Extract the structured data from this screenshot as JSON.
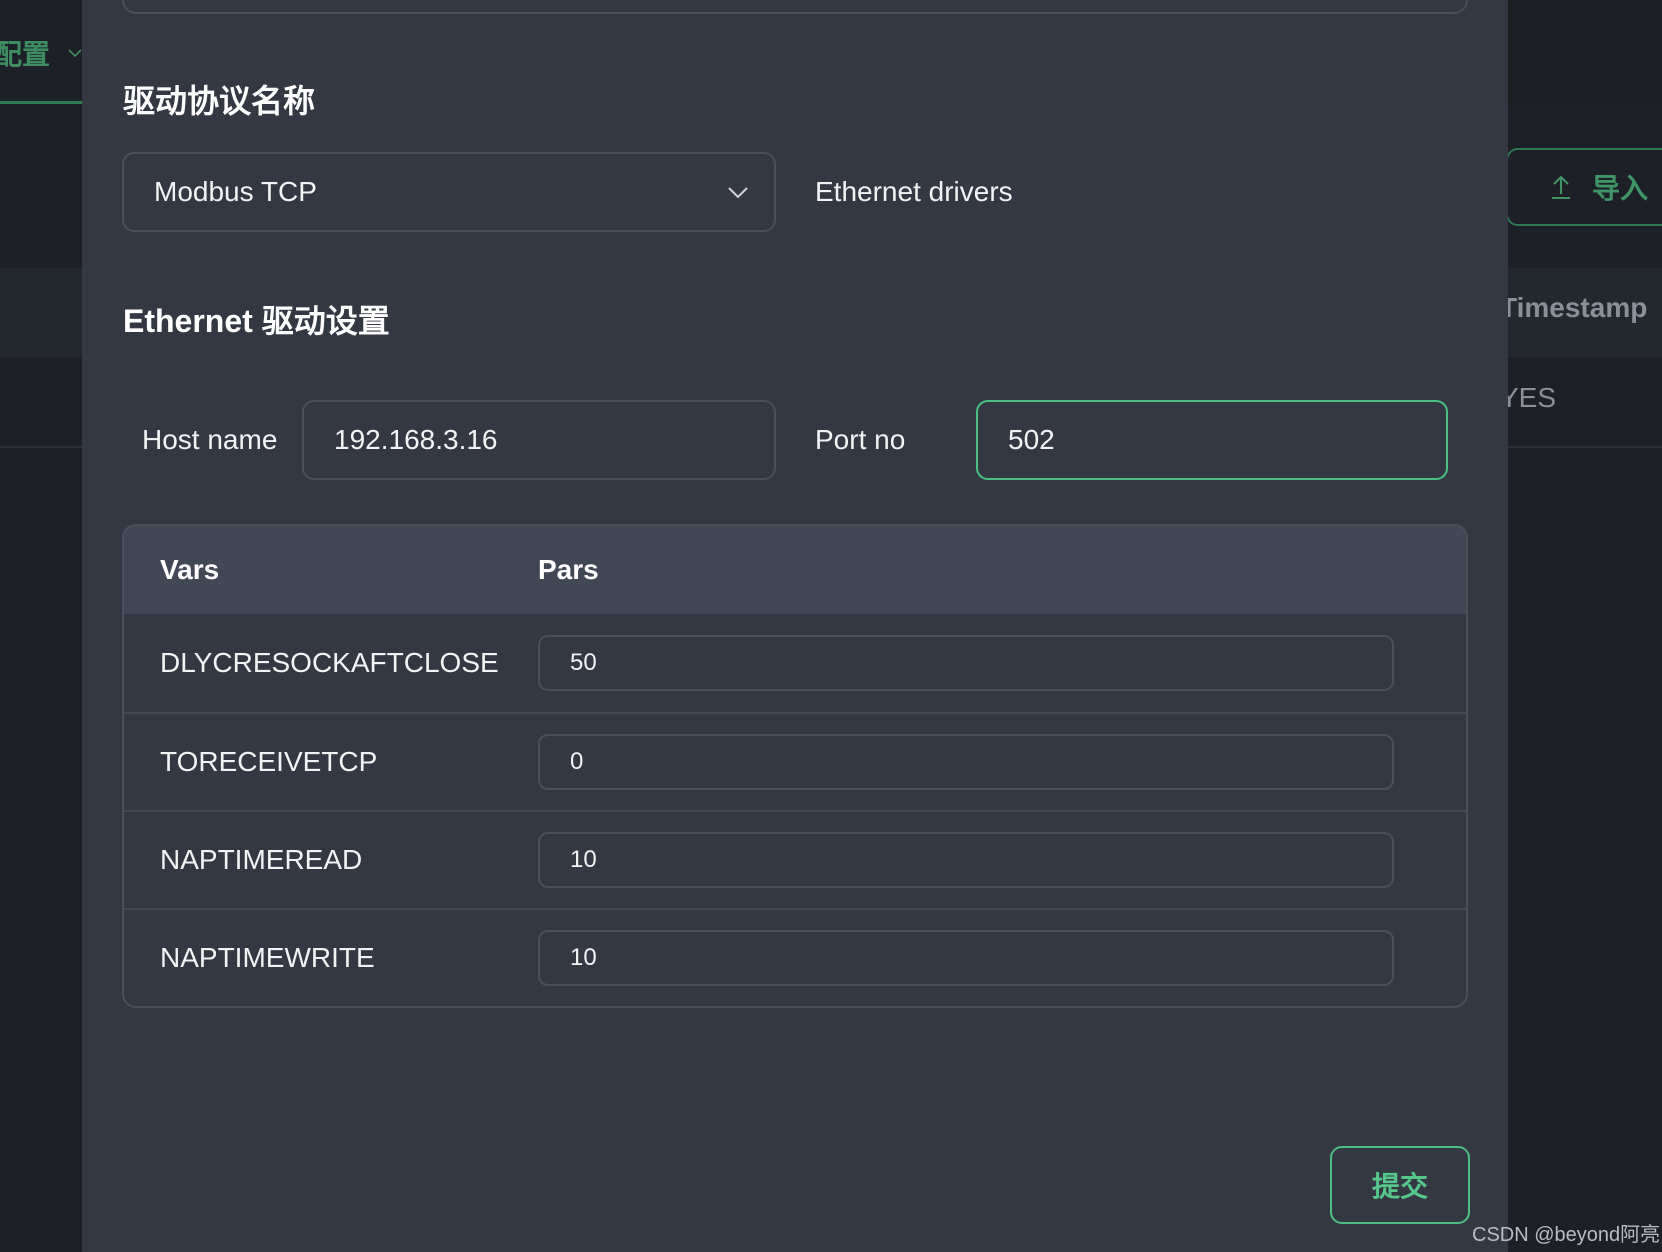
{
  "background": {
    "left_tab_label": "配置",
    "import_button_label": "导入",
    "column_header": "Timestamp",
    "cell_value": "YES",
    "watermark": "CSDN @beyond阿亮"
  },
  "modal": {
    "protocol_section_title": "驱动协议名称",
    "protocol_select_value": "Modbus TCP",
    "protocol_description": "Ethernet drivers",
    "settings_section_title": "Ethernet 驱动设置",
    "host_label": "Host name",
    "host_value": "192.168.3.16",
    "port_label": "Port no",
    "port_value": "502",
    "table": {
      "headers": [
        "Vars",
        "Pars"
      ],
      "rows": [
        {
          "var": "DLYCRESOCKAFTCLOSE",
          "par": "50"
        },
        {
          "var": "TORECEIVETCP",
          "par": "0"
        },
        {
          "var": "NAPTIMEREAD",
          "par": "10"
        },
        {
          "var": "NAPTIMEWRITE",
          "par": "10"
        }
      ]
    },
    "submit_label": "提交"
  },
  "colors": {
    "accent": "#4cbf83",
    "modal_bg": "#343843",
    "table_header_bg": "#414755"
  }
}
